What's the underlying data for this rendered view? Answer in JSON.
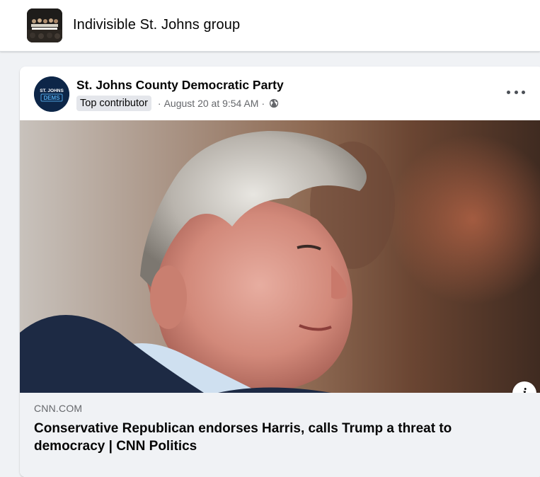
{
  "group": {
    "title": "Indivisible St. Johns group",
    "avatar_icon": "group-photo-icon"
  },
  "post": {
    "author": "St. Johns County Democratic Party",
    "avatar_text_top": "ST. JOHNS",
    "avatar_text_bottom": "DEMS",
    "badge": "Top contributor",
    "separator": "·",
    "timestamp": "August 20 at 9:54 AM",
    "audience_icon": "globe-icon",
    "more_icon": "more-options-icon",
    "link": {
      "domain": "CNN.COM",
      "headline": "Conservative Republican endorses Harris, calls Trump a threat to democracy | CNN Politics",
      "info_label": "i"
    }
  },
  "colors": {
    "background": "#f0f2f5",
    "card": "#ffffff",
    "text_primary": "#050505",
    "text_secondary": "#65676b",
    "badge_bg": "#e4e6eb"
  }
}
